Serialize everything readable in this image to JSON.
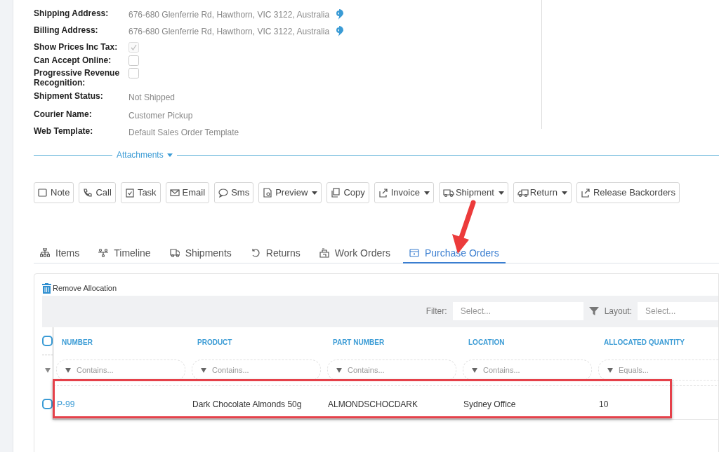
{
  "details": [
    {
      "label": "Shipping Address:",
      "kind": "address",
      "value": "676-680 Glenferrie Rd, Hawthorn, VIC 3122, Australia"
    },
    {
      "label": "Billing Address:",
      "kind": "address",
      "value": "676-680 Glenferrie Rd, Hawthorn, VIC 3122, Australia"
    },
    {
      "label": "Show Prices Inc Tax:",
      "kind": "checkbox",
      "checked": true,
      "disabled": true
    },
    {
      "label": "Can Accept Online:",
      "kind": "checkbox",
      "checked": false,
      "disabled": false
    },
    {
      "label": "Progressive Revenue Recognition:",
      "kind": "checkbox",
      "checked": false,
      "disabled": false
    },
    {
      "label": "Shipment Status:",
      "kind": "text",
      "value": "Not Shipped"
    },
    {
      "label": "Courier Name:",
      "kind": "text",
      "value": "Customer Pickup"
    },
    {
      "label": "Web Template:",
      "kind": "text",
      "value": "Default Sales Order Template"
    }
  ],
  "attachments": {
    "label": "Attachments",
    "expanded": false
  },
  "actions": [
    {
      "label": "Note",
      "dropdown": false
    },
    {
      "label": "Call",
      "dropdown": false
    },
    {
      "label": "Task",
      "dropdown": false
    },
    {
      "label": "Email",
      "dropdown": false
    },
    {
      "label": "Sms",
      "dropdown": false
    },
    {
      "label": "Preview",
      "dropdown": true
    },
    {
      "label": "Copy",
      "dropdown": false
    },
    {
      "label": "Invoice",
      "dropdown": true
    },
    {
      "label": "Shipment",
      "dropdown": true
    },
    {
      "label": "Return",
      "dropdown": true
    },
    {
      "label": "Release Backorders",
      "dropdown": false
    }
  ],
  "tabs": [
    {
      "label": "Items",
      "selected": false
    },
    {
      "label": "Timeline",
      "selected": false
    },
    {
      "label": "Shipments",
      "selected": false
    },
    {
      "label": "Returns",
      "selected": false
    },
    {
      "label": "Work Orders",
      "selected": false
    },
    {
      "label": "Purchase Orders",
      "selected": true
    }
  ],
  "grid": {
    "toolbar_button": "Remove Allocation",
    "filter": {
      "label": "Filter:",
      "placeholder": "Select..."
    },
    "layout": {
      "label": "Layout:",
      "placeholder": "Select..."
    },
    "columns": [
      {
        "label": "NUMBER",
        "filter_placeholder": "Contains..."
      },
      {
        "label": "PRODUCT",
        "filter_placeholder": "Contains..."
      },
      {
        "label": "PART NUMBER",
        "filter_placeholder": "Contains..."
      },
      {
        "label": "LOCATION",
        "filter_placeholder": "Contains..."
      },
      {
        "label": "ALLOCATED QUANTITY",
        "filter_placeholder": "Equals..."
      }
    ],
    "all_selected": false,
    "rows": [
      {
        "selected": false,
        "highlighted": true,
        "cells": [
          "P-99",
          "Dark Chocolate Almonds 50g",
          "ALMONDSCHOCDARK",
          "Sydney Office",
          "10"
        ]
      }
    ]
  }
}
